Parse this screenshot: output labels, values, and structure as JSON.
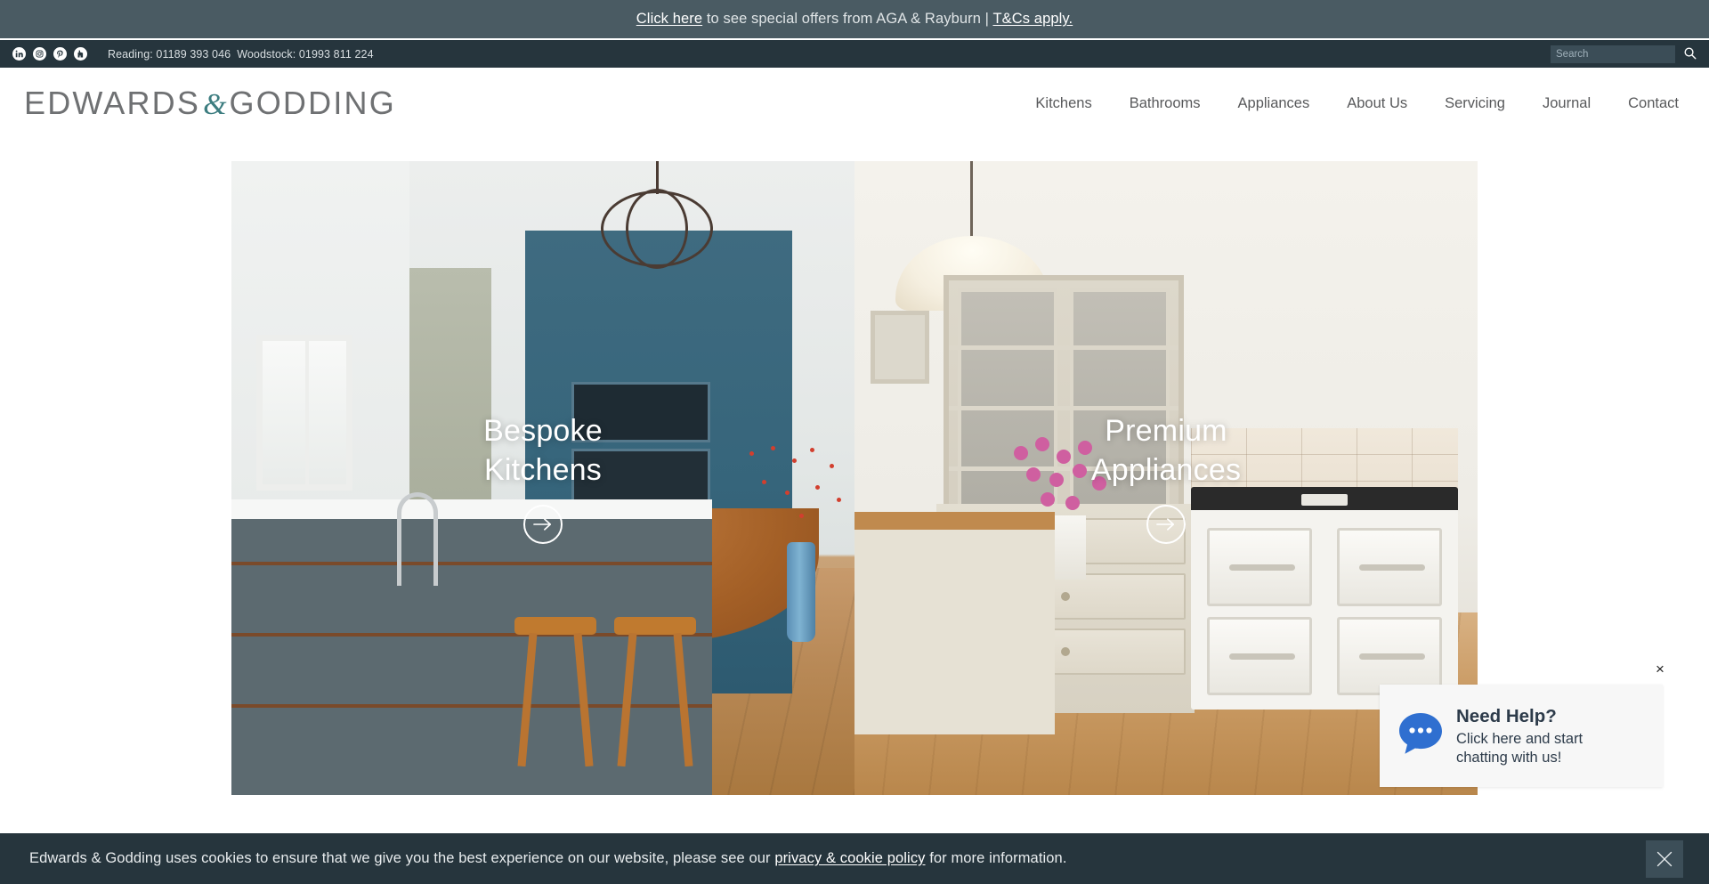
{
  "promo": {
    "link_label": "Click here",
    "text_middle": " to see special offers from AGA & Rayburn | ",
    "tcs_label": "T&Cs apply.",
    "background": "#4a5b63"
  },
  "utility": {
    "social": [
      {
        "name": "linkedin-icon",
        "label": "in"
      },
      {
        "name": "instagram-icon",
        "label": "ig"
      },
      {
        "name": "pinterest-icon",
        "label": "P"
      },
      {
        "name": "houzz-icon",
        "label": "h"
      }
    ],
    "phones": {
      "reading": "Reading: 01189 393 046",
      "woodstock": "Woodstock: 01993 811 224"
    },
    "search_placeholder": "Search",
    "search_value": "",
    "background": "#26353d"
  },
  "header": {
    "logo_first": "EDWARDS",
    "logo_amp": "&",
    "logo_last": "GODDING",
    "amp_color": "#3d7d80",
    "nav": [
      {
        "label": "Kitchens"
      },
      {
        "label": "Bathrooms"
      },
      {
        "label": "Appliances"
      },
      {
        "label": "About Us"
      },
      {
        "label": "Servicing"
      },
      {
        "label": "Journal"
      },
      {
        "label": "Contact"
      }
    ]
  },
  "hero": {
    "panels": [
      {
        "title_line1": "Bespoke",
        "title_line2": "Kitchens"
      },
      {
        "title_line1": "Premium",
        "title_line2": "Appliances"
      }
    ]
  },
  "chat": {
    "title": "Need Help?",
    "line1": "Click here and start",
    "line2": "chatting with us!",
    "close_label": "×",
    "accent": "#2f6fd0"
  },
  "cookie": {
    "text_before": "Edwards & Godding uses cookies to ensure that we give you the best experience on our website, please see our ",
    "link_label": "privacy & cookie policy",
    "text_after": " for more information.",
    "background": "#26353d"
  }
}
